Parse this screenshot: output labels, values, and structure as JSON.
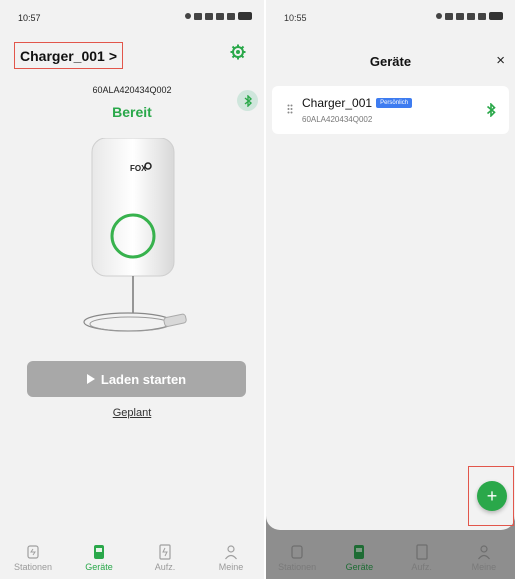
{
  "left": {
    "status_time": "10:57",
    "charger_name": "Charger_001",
    "chevron": ">",
    "serial": "60ALA420434Q002",
    "state": "Bereit",
    "brand": "FOX",
    "start_label": "Laden starten",
    "planned_label": "Geplant"
  },
  "right": {
    "status_time": "10:55",
    "title": "Geräte",
    "close": "×",
    "device": {
      "name": "Charger_001",
      "badge": "Persönlich",
      "serial": "60ALA420434Q002"
    },
    "add": "+"
  },
  "tabs": [
    {
      "label": "Stationen",
      "icon": "station-icon"
    },
    {
      "label": "Geräte",
      "icon": "charger-icon"
    },
    {
      "label": "Aufz.",
      "icon": "records-icon"
    },
    {
      "label": "Meine",
      "icon": "profile-icon"
    }
  ],
  "colors": {
    "accent": "#2aa84a",
    "highlight": "#e2564b",
    "badge": "#3e7cf0"
  }
}
